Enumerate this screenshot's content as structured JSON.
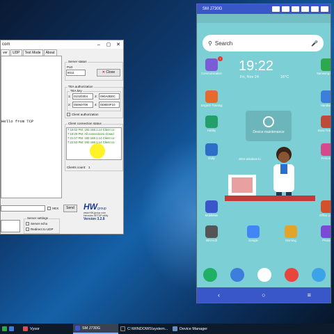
{
  "hercules": {
    "title_fragment": "com",
    "tabs": [
      "ver",
      "UDP",
      "Test Mode",
      "About"
    ],
    "received_line": "Hello from TCP",
    "server_status": {
      "legend": "Server status",
      "port_label": "Port",
      "port_value": "8011",
      "close_button": "Close"
    },
    "tea": {
      "legend": "TEA authorization",
      "key_legend": "TEA key",
      "keys": [
        {
          "n": "1:",
          "v": "01020304"
        },
        {
          "n": "3:",
          "v": "090A0B0C"
        },
        {
          "n": "2:",
          "v": "05060708"
        },
        {
          "n": "4:",
          "v": "0D0E0F10"
        }
      ],
      "client_auth": "Client authorization"
    },
    "client_status": {
      "legend": "Client connection status",
      "rows": [
        "7:19:02 PM:  192.168.1.14 Client co",
        "7:19:29 PM:  All connections closed",
        "7:21:07 PM:  192.168.1.14 Client co",
        "7:21:53 PM:  192.168.1.14 Client co"
      ],
      "count_label": "Clients count:",
      "count_value": "1"
    },
    "send": {
      "hex_label": "HEX",
      "send_button": "Send"
    },
    "server_settings": {
      "legend": "Server settings",
      "server_echo": "Server echo",
      "redirect": "Redirect to UDP"
    },
    "logo": {
      "hw": "HW",
      "group": "group",
      "url": "www.HW-group.com",
      "name": "Hercules SETUP utility",
      "version": "Version  3.2.8"
    }
  },
  "phone": {
    "window_title": "SM J730G",
    "search_placeholder": "Search",
    "time": "19:22",
    "date": "Fri, Nov 24",
    "temperature": "16°C",
    "apps": [
      {
        "label": "Communication",
        "color": "#7c5cd6"
      },
      {
        "label": "Samsung Health",
        "color": "#2ea84f"
      },
      {
        "label": "English Training",
        "color": "#e46a2d"
      },
      {
        "label": "Handsets",
        "color": "#3d7ddb"
      },
      {
        "label": "Hobby",
        "color": "#23a06a"
      },
      {
        "label": "Boss Training",
        "color": "#c04a3a"
      },
      {
        "label": "Daily",
        "color": "#2d6ec9"
      },
      {
        "label": "Personal",
        "color": "#d44a8a"
      },
      {
        "label": "MobiMain",
        "color": "#3a57c9"
      },
      {
        "label": "Office Lens",
        "color": "#d4502a"
      },
      {
        "label": "Mini-soft",
        "color": "#555555"
      },
      {
        "label": "Google",
        "color": "#4285f4"
      },
      {
        "label": "Morning",
        "color": "#e2a52a"
      },
      {
        "label": "Photos",
        "color": "#7a4ad6"
      }
    ],
    "badge": "7",
    "widget_label": "Device maintenance",
    "wifi_label": "SDS-wireless lo",
    "nav": [
      "‹",
      "○",
      "≡"
    ]
  },
  "taskbar": {
    "items": [
      {
        "label": "Vysor",
        "color": "#e04c4c"
      },
      {
        "label": "SM J730G",
        "color": "#3a57c9"
      },
      {
        "label": "C:\\WINDOWS\\system...",
        "color": "#222222"
      },
      {
        "label": "Device Manager",
        "color": "#6a8fb8"
      }
    ]
  }
}
